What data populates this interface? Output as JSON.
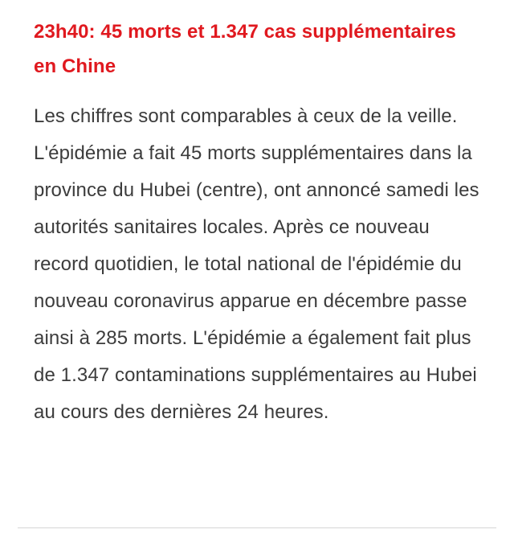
{
  "article": {
    "headline": "23h40: 45 morts et 1.347 cas supplémentaires en Chine",
    "body": "Les chiffres sont comparables à ceux de la veille. L'épidémie a fait 45 morts supplémentaires dans la province du Hubei (centre), ont annoncé samedi les autorités sanitaires locales. Après ce nouveau record quotidien, le total national de l'épidémie du nouveau coronavirus apparue en décembre passe ainsi à 285 morts. L'épidémie a également fait plus de 1.347 contaminations supplémentaires au Hubei au cours des dernières 24 heures."
  },
  "colors": {
    "headline": "#e0191f",
    "body_text": "#3c3c3c",
    "divider": "#d6d6d6",
    "background": "#ffffff"
  }
}
